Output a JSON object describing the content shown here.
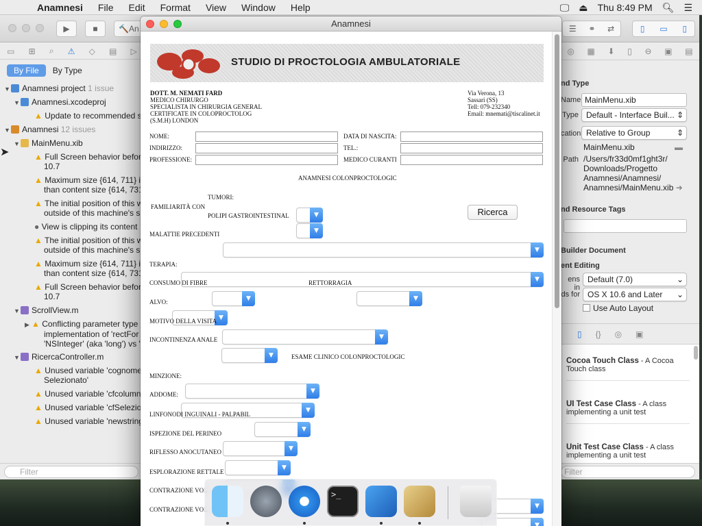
{
  "menubar": {
    "app": "Anamnesi",
    "items": [
      "File",
      "Edit",
      "Format",
      "View",
      "Window",
      "Help"
    ],
    "clock": "Thu 8:49 PM"
  },
  "xcode": {
    "scheme_text": "An",
    "nav_segments": [
      "By File",
      "By Type"
    ],
    "tree": [
      {
        "label": "Anamnesi project",
        "badge": "1 issue",
        "kind": "project"
      },
      {
        "label": "Anamnesi.xcodeproj",
        "kind": "file"
      },
      {
        "label": "Update to recommended s",
        "kind": "warning"
      },
      {
        "label": "Anamnesi",
        "badge": "12 issues",
        "kind": "folder"
      },
      {
        "label": "MainMenu.xib",
        "kind": "file"
      },
      {
        "label": "Full Screen behavior befor",
        "label2": "10.7",
        "kind": "warning"
      },
      {
        "label": "Maximum size {614, 711} is",
        "label2": "than content size {614, 731",
        "kind": "warning"
      },
      {
        "label": "The initial position of this w",
        "label2": "outside of this machine's s",
        "kind": "warning"
      },
      {
        "label": "View is clipping its content",
        "kind": "error"
      },
      {
        "label": "The initial position of this w",
        "label2": "outside of this machine's s",
        "kind": "warning"
      },
      {
        "label": "Maximum size {614, 711} is",
        "label2": "than content size {614, 731",
        "kind": "warning"
      },
      {
        "label": "Full Screen behavior befor",
        "label2": "10.7",
        "kind": "warning"
      },
      {
        "label": "ScrollView.m",
        "kind": "file"
      },
      {
        "label": "Conflicting parameter type",
        "label2": "implementation of 'rectFor",
        "label3": "'NSInteger' (aka 'long') vs '",
        "kind": "warning"
      },
      {
        "label": "RicercaController.m",
        "kind": "file"
      },
      {
        "label": "Unused variable 'cognome",
        "label2": "Selezionato'",
        "kind": "warning"
      },
      {
        "label": "Unused variable 'cfcolumn",
        "kind": "warning"
      },
      {
        "label": "Unused variable 'cfSelezio",
        "kind": "warning"
      },
      {
        "label": "Unused variable 'newstring",
        "kind": "warning"
      }
    ],
    "filter_placeholder": "Filter",
    "inspector": {
      "h_identity": "nd Type",
      "name_label": "Name",
      "name_value": "MainMenu.xib",
      "type_label": "Type",
      "type_value": "Default - Interface Buil...",
      "location_label": "cation",
      "location_value": "Relative to Group",
      "file_name": "MainMenu.xib",
      "path_label": "Path",
      "path_value": [
        "/Users/fr33d0mf1ght3r/",
        "Downloads/Progetto",
        "Anamnesi/Anamnesi/",
        "Anamnesi/MainMenu.xib"
      ],
      "h_tags": "nd Resource Tags",
      "h_ibdoc": "Builder Document",
      "h_editing": "ent Editing",
      "opens_label": "ens in",
      "opens_value": "Default (7.0)",
      "builds_label": "ds for",
      "builds_value": "OS X 10.6 and Later",
      "autolayout": "Use Auto Layout"
    },
    "library": [
      {
        "title": "Cocoa Touch Class",
        "desc": " - A Cocoa Touch class"
      },
      {
        "title": "UI Test Case Class",
        "desc": " - A class implementing a unit test"
      },
      {
        "title": "Unit Test Case Class",
        "desc": " - A class implementing a unit test"
      }
    ],
    "library_filter": "Filter"
  },
  "sim": {
    "title": "Anamnesi",
    "banner": "STUDIO DI PROCTOLOGIA AMBULATORIALE",
    "doctor": [
      "DOTT. M. NEMATI FARD",
      "MEDICO CHIRURGO",
      "SPECIALISTA IN CHIRURGIA GENERAL",
      "CERTIFICATE IN COLOPROCTOLOG",
      "(S.M.H)  LONDON"
    ],
    "address": [
      "Via Verona, 13",
      "Sassari (SS)",
      "Tell: 079-232340",
      "Email: mnemati@tiscalinet.it"
    ],
    "fields": {
      "nome": "NOME:",
      "indirizzo": "INDIRIZZO:",
      "professione": "PROFESSIONE:",
      "data_nascita": "DATA DI NASCITA:",
      "tel": "TEL.:",
      "medico": "MEDICO CURANTI"
    },
    "section1": "ANAMNESI COLONPROCTOLOGIC",
    "familiarita": "FAMILIARITÀ CON",
    "tumori": "TUMORI:",
    "polipi": "POLIPI GASTROINTESTINAL",
    "ricerca": "Ricerca",
    "malattie": "MALATTIE PRECEDENTI",
    "terapia": "TERAPIA:",
    "consumo": "CONSUMO DI FIBRE",
    "rettorragia": "RETTORRAGIA",
    "alvo": "ALVO:",
    "motivo": "MOTIVO DELLA VISITA",
    "incontinenza": "INCONTINENZA ANALE",
    "section2": "ESAME CLINICO COLONPROCTOLOGIC",
    "minzione": "MINZIONE:",
    "addome": "ADDOME:",
    "linfonodi": "LINFONODI INGUINALI - PALPABIL",
    "ispezione": "ISPEZIONE DEL PERINEO",
    "riflesso": "RIFLESSO ANOCUTANEO",
    "esplorazione": "ESPLORAZIONE RETTALE",
    "contrazione1": "CONTRAZIONE VOL",
    "contrazione2": "CONTRAZIONE VOL"
  },
  "dock": [
    "Finder",
    "Launchpad",
    "Safari",
    "Terminal",
    "Xcode",
    "Script Editor",
    "Trash"
  ]
}
